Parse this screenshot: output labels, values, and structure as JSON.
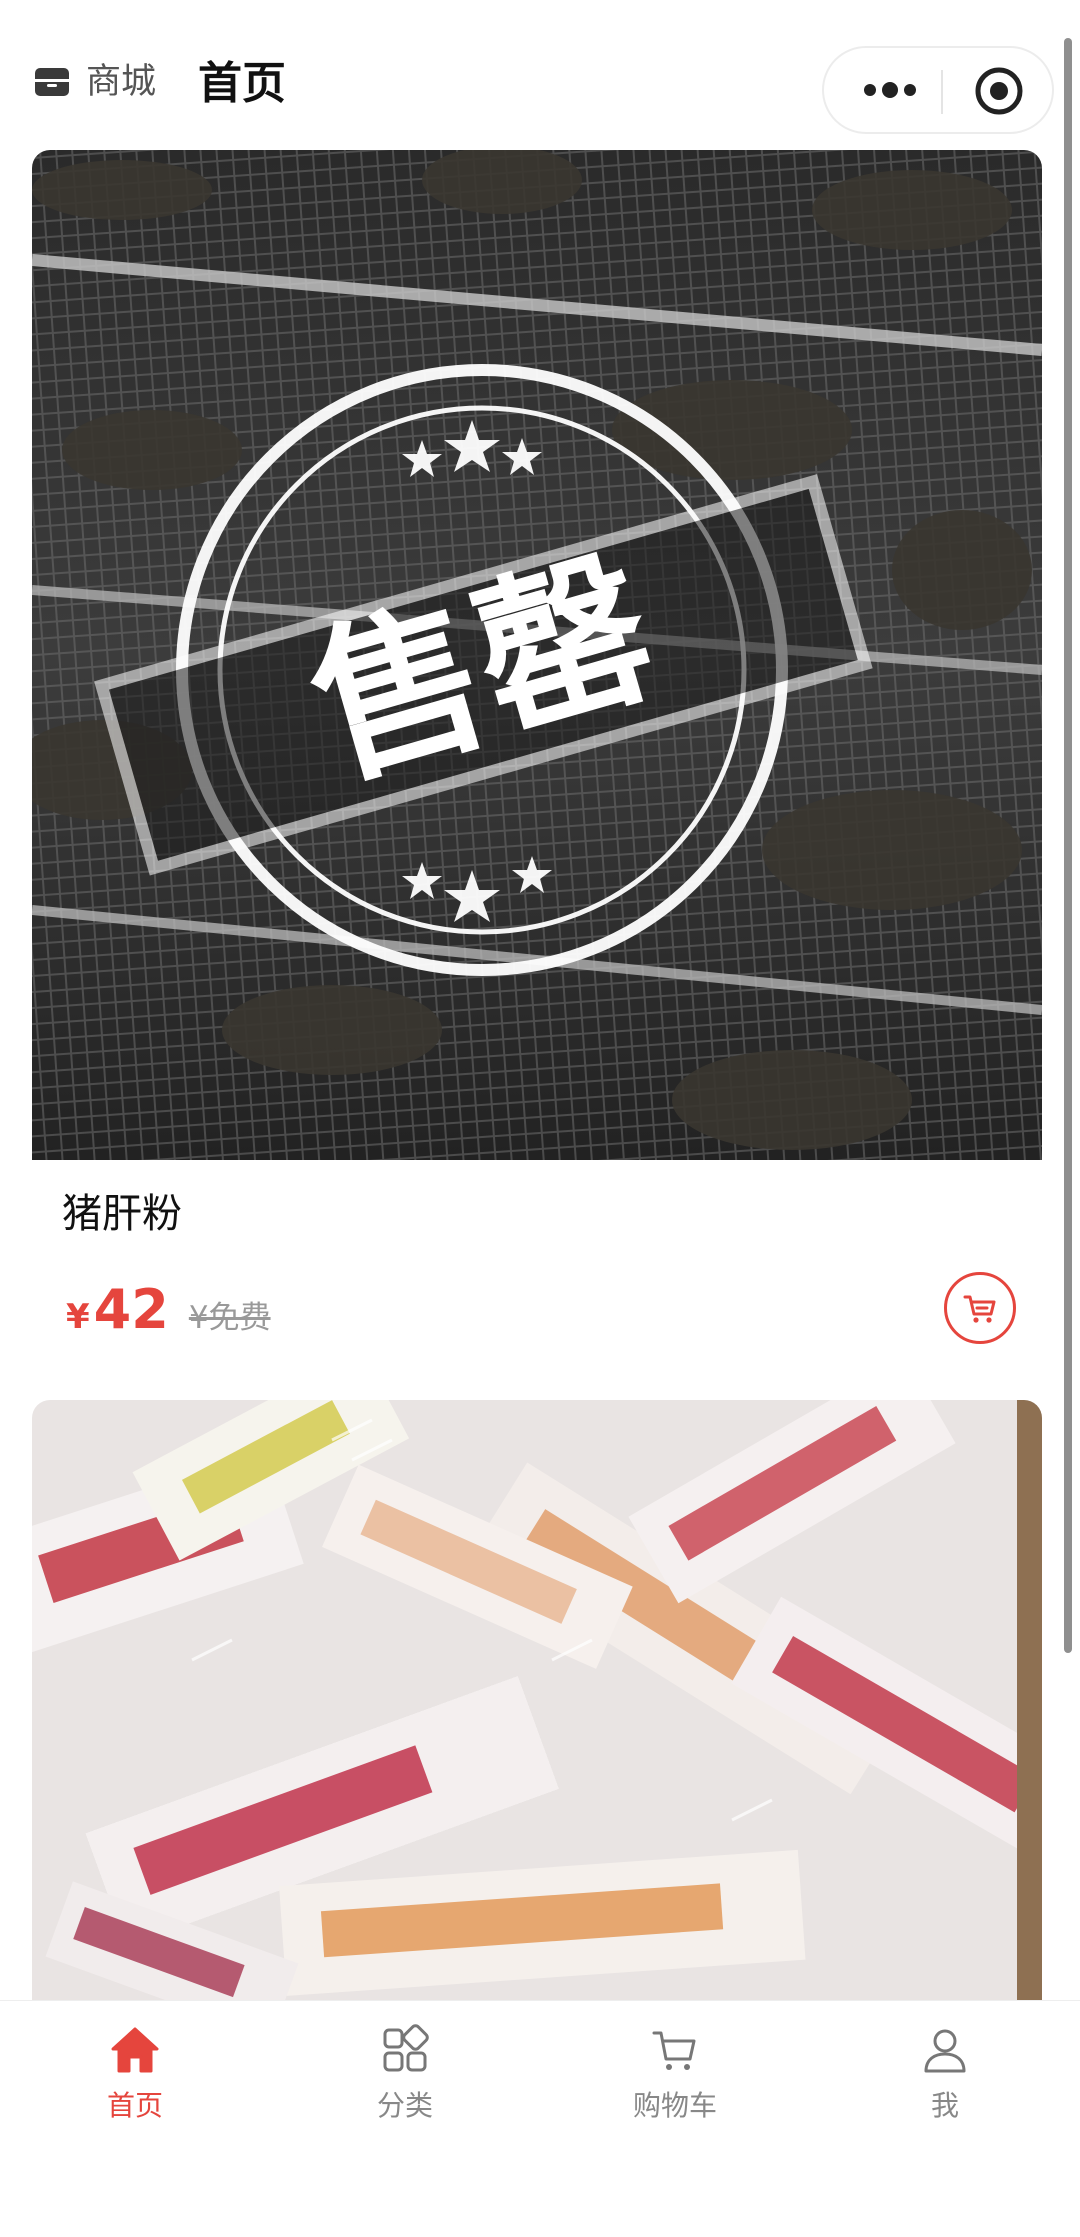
{
  "header": {
    "store_label": "商城",
    "title": "首页",
    "store_icon": "shop-icon",
    "more_icon": "more-dots-icon",
    "close_icon": "close-miniprogram-icon"
  },
  "products": [
    {
      "name": "猪肝粉",
      "price_symbol": "¥",
      "price": "42",
      "original_price": "¥免费",
      "stamp_text": "售罄",
      "sold_out": true,
      "cart_icon": "cart-icon"
    },
    {
      "name": "",
      "image": "fruit-sticks-photo"
    }
  ],
  "tabbar": {
    "items": [
      {
        "label": "首页",
        "icon": "home-icon",
        "active": true
      },
      {
        "label": "分类",
        "icon": "category-icon",
        "active": false
      },
      {
        "label": "购物车",
        "icon": "cart-icon",
        "active": false
      },
      {
        "label": "我",
        "icon": "user-icon",
        "active": false
      }
    ]
  },
  "colors": {
    "accent": "#e5453d",
    "text_primary": "#111111",
    "text_secondary": "#888888"
  }
}
